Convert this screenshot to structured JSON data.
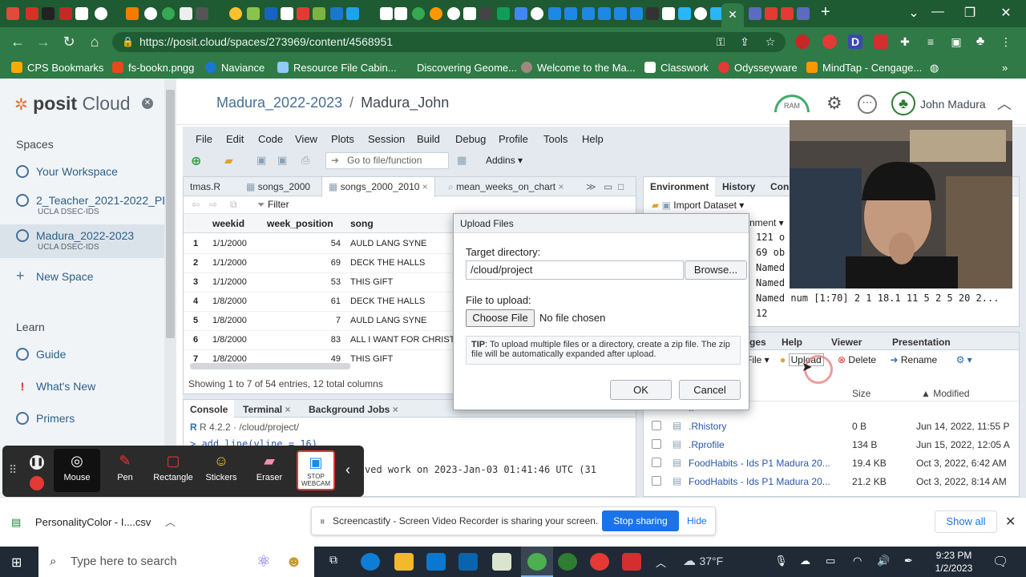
{
  "browser": {
    "url": "https://posit.cloud/spaces/273969/content/4568951",
    "bookmarks": [
      "CPS Bookmarks",
      "fs-bookn.pngg",
      "Naviance",
      "Resource File Cabin...",
      "Discovering Geome...",
      "Welcome to the Ma...",
      "Classwork",
      "Odysseyware",
      "MindTap - Cengage..."
    ]
  },
  "sidebar": {
    "logo_text": "posit",
    "logo_suffix": "Cloud",
    "spaces_heading": "Spaces",
    "items": [
      {
        "label": "Your Workspace"
      },
      {
        "label": "2_Teacher_2021-2022_PD",
        "sub": "UCLA DSEC-IDS"
      },
      {
        "label": "Madura_2022-2023",
        "sub": "UCLA DSEC-IDS"
      },
      {
        "label": "New Space"
      }
    ],
    "learn_heading": "Learn",
    "learn_items": [
      "Guide",
      "What's New",
      "Primers"
    ]
  },
  "header": {
    "breadcrumb_space": "Madura_2022-2023",
    "breadcrumb_sep": "/",
    "project": "Madura_John",
    "ram_label": "RAM",
    "user_name": "John Madura"
  },
  "rstudio": {
    "menus": [
      "File",
      "Edit",
      "Code",
      "View",
      "Plots",
      "Session",
      "Build",
      "Debug",
      "Profile",
      "Tools",
      "Help"
    ],
    "goto_placeholder": "Go to file/function",
    "addins": "Addins",
    "editor_tabs": [
      "tmas.R",
      "songs_2000",
      "songs_2000_2010",
      "mean_weeks_on_chart"
    ],
    "filter_label": "Filter",
    "columns": [
      "weekid",
      "week_position",
      "song"
    ],
    "rows": [
      [
        "1",
        "1/1/2000",
        "54",
        "AULD LANG SYNE"
      ],
      [
        "2",
        "1/1/2000",
        "69",
        "DECK THE HALLS"
      ],
      [
        "3",
        "1/1/2000",
        "53",
        "THIS GIFT"
      ],
      [
        "4",
        "1/8/2000",
        "61",
        "DECK THE HALLS"
      ],
      [
        "5",
        "1/8/2000",
        "7",
        "AULD LANG SYNE"
      ],
      [
        "6",
        "1/8/2000",
        "83",
        "ALL I WANT FOR CHRISTM"
      ],
      [
        "7",
        "1/8/2000",
        "49",
        "THIS GIFT"
      ]
    ],
    "showing": "Showing 1 to 7 of 54 entries, 12 total columns",
    "console_tabs": [
      "Console",
      "Terminal",
      "Background Jobs"
    ],
    "r_version": "R 4.2.2 · /cloud/project/",
    "console_line1": "> add_line(vline = 16)",
    "console_line2": "ved work on 2023-Jan-03 01:41:46 UTC (31",
    "env_tabs": [
      "Environment",
      "History",
      "Con"
    ],
    "import_dataset": "Import Dataset",
    "env_lines": [
      "121 o",
      "69 ob",
      "Named",
      "Named num [1:2] 12 10.5",
      "Named num [1:70] 2 1 18.1 11 5 2 5 20 2...",
      "12"
    ],
    "files_tabs": [
      "ges",
      "Help",
      "Viewer",
      "Presentation"
    ],
    "files_actions": [
      "File",
      "Upload",
      "Delete",
      "Rename"
    ],
    "files_cols": [
      "Size",
      "Modified"
    ],
    "files": [
      {
        "name": "..",
        "size": "",
        "modified": ""
      },
      {
        "name": ".Rhistory",
        "size": "0 B",
        "modified": "Jun 14, 2022, 11:55 P"
      },
      {
        "name": ".Rprofile",
        "size": "134 B",
        "modified": "Jun 15, 2022, 12:05 A"
      },
      {
        "name": "FoodHabits - Ids P1 Madura 20...",
        "size": "19.4 KB",
        "modified": "Oct 3, 2022, 6:42 AM"
      },
      {
        "name": "FoodHabits - Ids P1 Madura 20...",
        "size": "21.2 KB",
        "modified": "Oct 3, 2022, 8:14 AM"
      }
    ]
  },
  "dialog": {
    "title": "Upload Files",
    "target_label": "Target directory:",
    "target_value": "/cloud/project",
    "browse": "Browse...",
    "file_label": "File to upload:",
    "choose_file": "Choose File",
    "no_file": "No file chosen",
    "tip_bold": "TIP",
    "tip_text": ": To upload multiple files or a directory, create a zip file. The zip file will be automatically expanded after upload.",
    "ok": "OK",
    "cancel": "Cancel"
  },
  "screencastify": {
    "tools": [
      "Mouse",
      "Pen",
      "Rectangle",
      "Stickers",
      "Eraser"
    ],
    "stop_webcam": "STOP WEBCAM",
    "sharing_text": "Screencastify - Screen Video Recorder is sharing your screen.",
    "stop_sharing": "Stop sharing",
    "hide": "Hide"
  },
  "download": {
    "file": "PersonalityColor - I....csv",
    "show_all": "Show all"
  },
  "taskbar": {
    "search_placeholder": "Type here to search",
    "temperature": "37°F",
    "time": "9:23 PM",
    "date": "1/2/2023"
  },
  "colors": {
    "chrome_green": "#2f7a46",
    "posit_blue": "#447099",
    "ok_accent": "#1a73e8"
  }
}
